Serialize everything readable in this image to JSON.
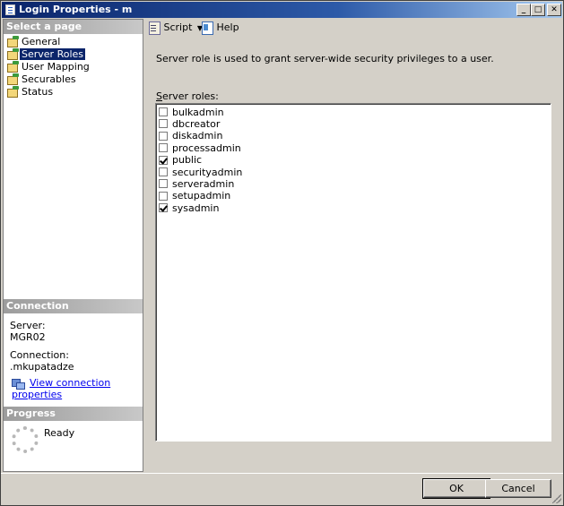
{
  "window": {
    "title": "Login Properties - m",
    "controls": {
      "minimize": "_",
      "maximize": "□",
      "close": "✕"
    }
  },
  "left": {
    "select_header": "Select a page",
    "pages": [
      {
        "label": "General",
        "selected": false
      },
      {
        "label": "Server Roles",
        "selected": true
      },
      {
        "label": "User Mapping",
        "selected": false
      },
      {
        "label": "Securables",
        "selected": false
      },
      {
        "label": "Status",
        "selected": false
      }
    ],
    "connection_header": "Connection",
    "server_label": "Server:",
    "server_value": "MGR02",
    "connection_label": "Connection:",
    "connection_value": ".mkupatadze",
    "view_link": "View connection properties",
    "progress_header": "Progress",
    "progress_status": "Ready"
  },
  "toolbar": {
    "script_label": "Script",
    "help_label": "Help"
  },
  "main": {
    "description": "Server role is used to grant server-wide security privileges to a user.",
    "roles_label_first": "S",
    "roles_label_rest": "erver roles:",
    "roles": [
      {
        "name": "bulkadmin",
        "checked": false
      },
      {
        "name": "dbcreator",
        "checked": false
      },
      {
        "name": "diskadmin",
        "checked": false
      },
      {
        "name": "processadmin",
        "checked": false
      },
      {
        "name": "public",
        "checked": true
      },
      {
        "name": "securityadmin",
        "checked": false
      },
      {
        "name": "serveradmin",
        "checked": false
      },
      {
        "name": "setupadmin",
        "checked": false
      },
      {
        "name": "sysadmin",
        "checked": true
      }
    ]
  },
  "buttons": {
    "ok": "OK",
    "cancel": "Cancel"
  }
}
